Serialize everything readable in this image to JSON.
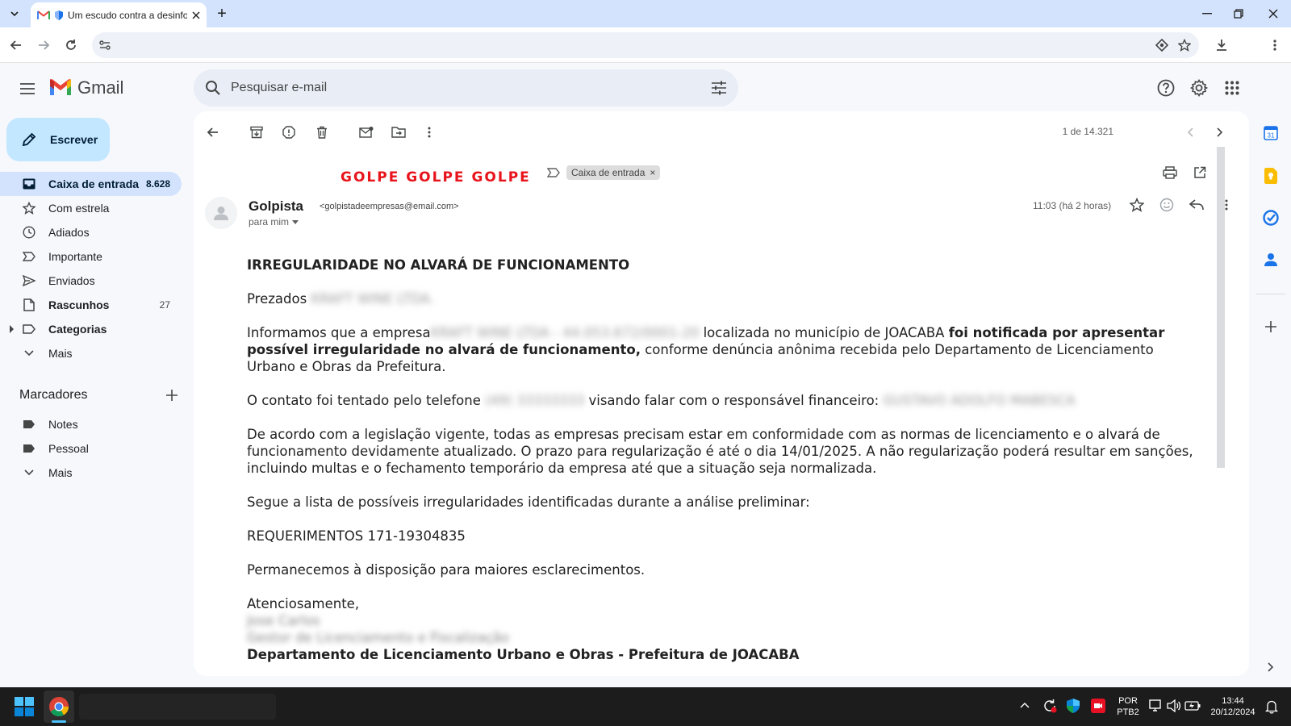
{
  "browser": {
    "tab_title": "Um escudo contra a desinfo",
    "new_tab_symbol": "+",
    "address": ""
  },
  "gmail": {
    "logo_text": "Gmail",
    "search_placeholder": "Pesquisar e-mail",
    "compose_label": "Escrever",
    "nav": [
      {
        "label": "Caixa de entrada",
        "count": "8.628",
        "icon": "inbox-icon"
      },
      {
        "label": "Com estrela",
        "count": "",
        "icon": "star-icon"
      },
      {
        "label": "Adiados",
        "count": "",
        "icon": "clock-icon"
      },
      {
        "label": "Importante",
        "count": "",
        "icon": "important-icon"
      },
      {
        "label": "Enviados",
        "count": "",
        "icon": "send-icon"
      },
      {
        "label": "Rascunhos",
        "count": "27",
        "icon": "draft-icon"
      },
      {
        "label": "Categorias",
        "count": "",
        "icon": "label-icon"
      },
      {
        "label": "Mais",
        "count": "",
        "icon": "chevron-down-icon"
      }
    ],
    "labels_title": "Marcadores",
    "labels": [
      {
        "label": "Notes",
        "icon": "label-icon"
      },
      {
        "label": "Pessoal",
        "icon": "label-icon"
      },
      {
        "label": "Mais",
        "icon": "chevron-down-icon"
      }
    ]
  },
  "message": {
    "pager": "1 de 14.321",
    "subject": "GOLPE GOLPE GOLPE",
    "chip_label": "Caixa de entrada",
    "chip_close": "×",
    "sender_name": "Golpista",
    "sender_email": "<golpistadeempresas@email.com>",
    "to_me": "para mim",
    "time": "11:03 (há 2 horas)",
    "body": {
      "heading": "IRREGULARIDADE NO ALVARÁ DE FUNCIONAMENTO",
      "greeting": "Prezados",
      "greeting_blurred": "KRAFT WINE LTDA.",
      "p1_start": "Informamos que a empresa",
      "p1_blurred": "KRAFT WINE LTDA - 44.053.672/0001-20",
      "p1_mid": " localizada no município de JOACABA ",
      "p1_bold": "foi notificada por apresentar possível irregularidade no alvará de funcionamento,",
      "p1_end": " conforme denúncia anônima recebida pelo Departamento de Licenciamento Urbano e Obras da Prefeitura.",
      "p2_start": "O contato foi tentado pelo telefone ",
      "p2_blurred": "(49) 33333333",
      "p2_mid": " visando falar com o responsável financeiro: ",
      "p2_blurred2": "GUSTAVO ADOLFO MABESCA",
      "p3": "De acordo com a legislação vigente, todas as empresas precisam estar em conformidade com as normas de licenciamento e o alvará de funcionamento devidamente atualizado. O prazo para regularização é até o dia 14/01/2025. A não regularização poderá resultar em sanções, incluindo multas e o fechamento temporário da empresa até que a situação seja normalizada.",
      "p4": "Segue a lista de possíveis irregularidades identificadas durante a análise preliminar:",
      "p5": "REQUERIMENTOS 171-19304835",
      "p6": "Permanecemos à disposição para maiores esclarecimentos.",
      "closing": "Atenciosamente,",
      "sig_name": "Jose Carlos",
      "sig_role": "Gestor de Licenciamento e Fiscalização",
      "sig_dept": "Departamento de Licenciamento Urbano e Obras - Prefeitura de JOACABA"
    }
  },
  "taskbar": {
    "lang_line1": "POR",
    "lang_line2": "PTB2",
    "time": "13:44",
    "date": "20/12/2024"
  },
  "colors": {
    "accent": "#0b57d0",
    "scam_red": "#e8141b",
    "compose_bg": "#c2e7ff",
    "active_nav": "#d3e3fd"
  }
}
